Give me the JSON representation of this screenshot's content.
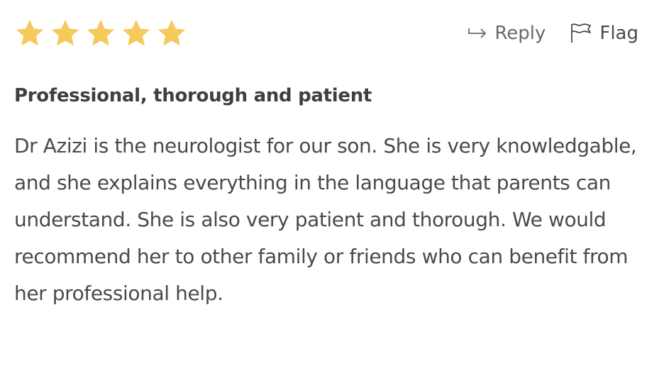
{
  "review": {
    "rating": 5,
    "max_rating": 5,
    "star_color": "#f6c95c",
    "title": "Professional, thorough and patient",
    "body": "Dr Azizi is the neurologist for our son. She is very knowledgable, and she explains everything in the language that parents can understand. She is also very patient and thorough. We would recommend her to other family or friends who can benefit from her professional help.",
    "actions": {
      "reply_label": "Reply",
      "reply_icon": "reply-arrow-icon",
      "flag_label": "Flag",
      "flag_icon": "flag-icon"
    }
  }
}
